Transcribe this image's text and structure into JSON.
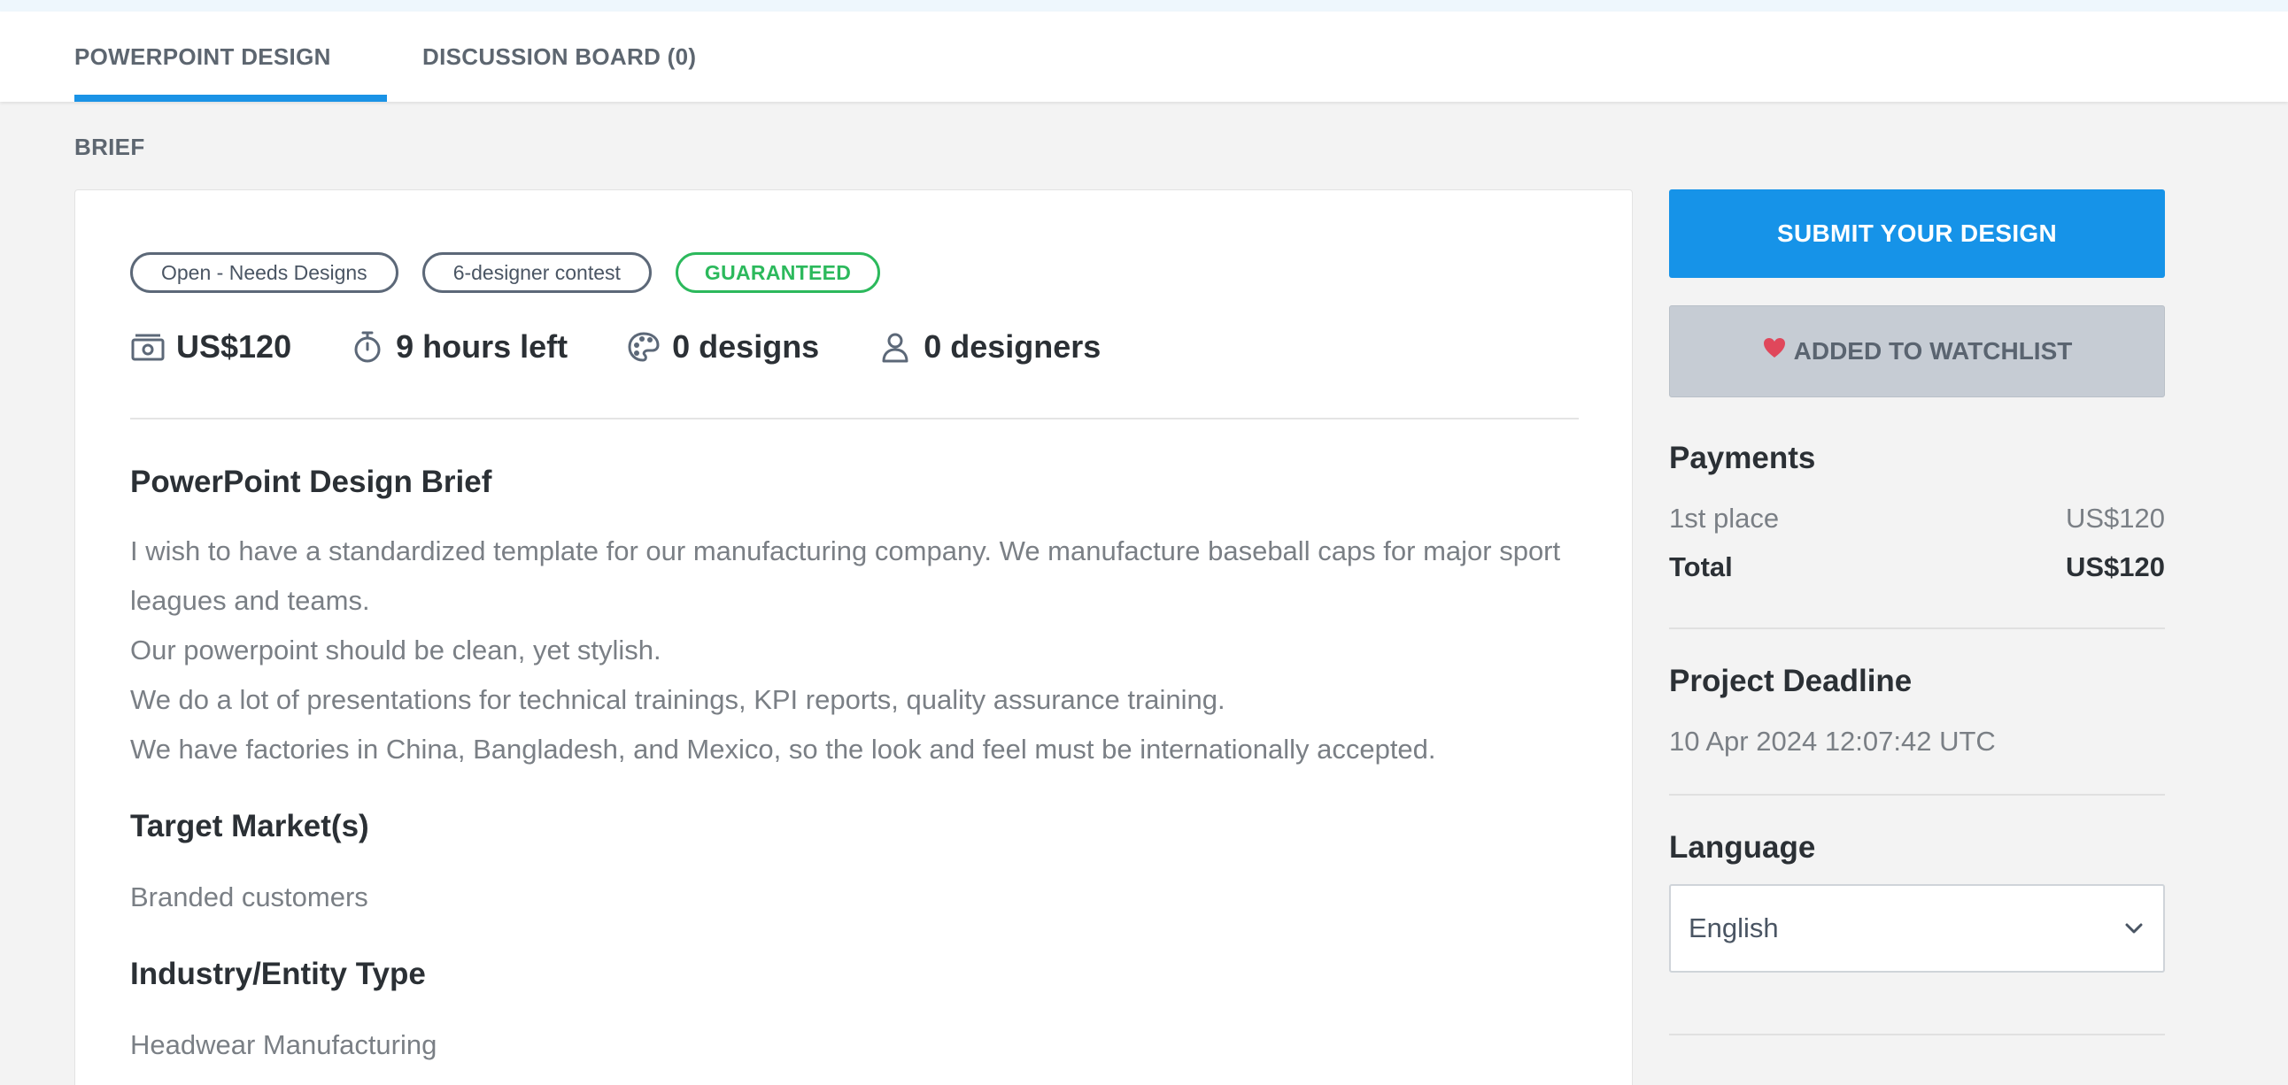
{
  "tabs": [
    {
      "label": "POWERPOINT DESIGN BRIEF",
      "active": true
    },
    {
      "label": "DISCUSSION BOARD (0)",
      "active": false
    }
  ],
  "badges": {
    "status": "Open - Needs Designs",
    "contest": "6-designer contest",
    "guaranteed": "GUARANTEED"
  },
  "stats": {
    "prize": "US$120",
    "time_left": "9 hours left",
    "designs": "0 designs",
    "designers": "0 designers"
  },
  "brief": {
    "title": "PowerPoint Design Brief",
    "paragraphs": [
      "I wish to have a standardized template for our manufacturing company. We manufacture baseball caps for major sport leagues and teams.",
      "Our powerpoint should be clean, yet stylish.",
      "We do a lot of presentations for technical trainings, KPI reports, quality assurance training.",
      "We have factories in China, Bangladesh, and Mexico, so the look and feel must be internationally accepted."
    ],
    "target_market_heading": "Target Market(s)",
    "target_market": "Branded customers",
    "industry_heading": "Industry/Entity Type",
    "industry": "Headwear Manufacturing"
  },
  "sidebar": {
    "submit_label": "SUBMIT YOUR DESIGN",
    "watchlist_label": "ADDED TO WATCHLIST",
    "payments_heading": "Payments",
    "first_place_label": "1st place",
    "first_place_value": "US$120",
    "total_label": "Total",
    "total_value": "US$120",
    "deadline_heading": "Project Deadline",
    "deadline_value": "10 Apr 2024 12:07:42 UTC",
    "language_heading": "Language",
    "language_value": "English"
  },
  "colors": {
    "accent": "#1693e8",
    "guaranteed": "#2cb95c",
    "heart": "#e0475b"
  }
}
